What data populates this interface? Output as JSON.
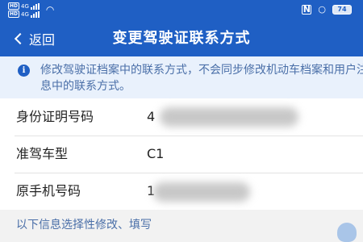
{
  "status_bar": {
    "sim1": {
      "badge": "HD",
      "network": "4G"
    },
    "sim2": {
      "badge": "HD",
      "network": "4G"
    },
    "wifi_icon": "wifi-icon",
    "nfc_label": "N",
    "alarm_icon": "alarm-icon",
    "battery": "74"
  },
  "header": {
    "back_label": "返回",
    "title": "变更驾驶证联系方式"
  },
  "notice": {
    "icon": "info-icon",
    "text": "修改驾驶证档案中的联系方式，不会同步修改机动车档案和用户注册信息中的联系方式。"
  },
  "form": {
    "rows": [
      {
        "label": "身份证明号码",
        "value": "4"
      },
      {
        "label": "准驾车型",
        "value": "C1"
      },
      {
        "label": "原手机号码",
        "value": "1"
      }
    ]
  },
  "section": {
    "hint": "以下信息选择性修改、填写"
  },
  "colors": {
    "brand_blue": "#1f5fc4",
    "notice_bg": "#e9f1fc",
    "notice_text": "#4a6fa8"
  }
}
